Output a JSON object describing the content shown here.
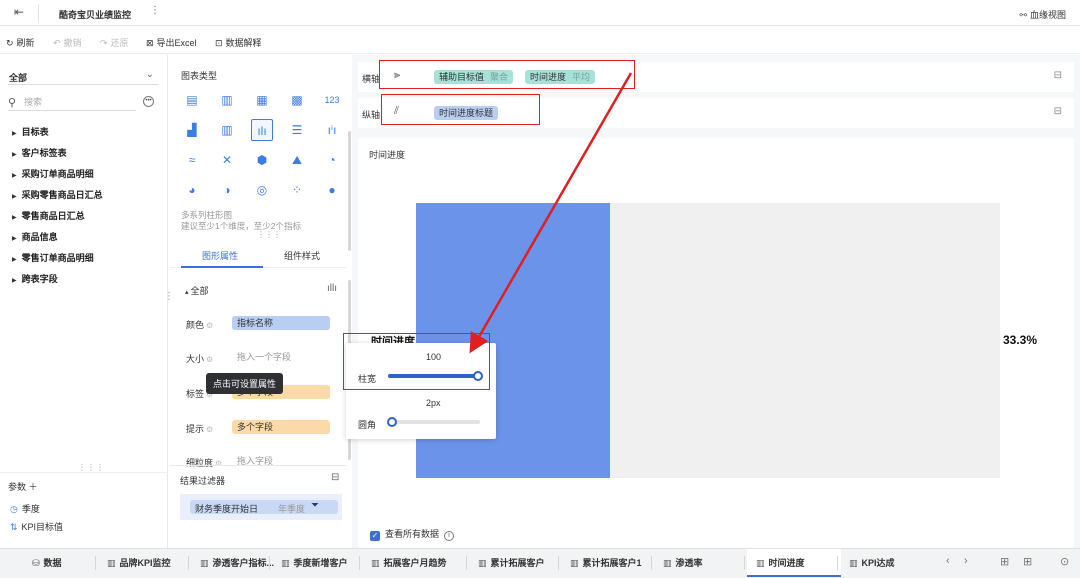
{
  "titlebar": {
    "back_icon": "exit-icon",
    "title": "酷奇宝贝业绩监控",
    "more": "⋮",
    "lineage_label": "血缘视图"
  },
  "toolbar": {
    "refresh": "刷新",
    "undo": "撤销",
    "redo": "还原",
    "export": "导出Excel",
    "explain": "数据解释"
  },
  "left": {
    "scope": "全部",
    "search_placeholder": "搜索",
    "tree": [
      "目标表",
      "客户标签表",
      "采购订单商品明细",
      "采购零售商品日汇总",
      "零售商品日汇总",
      "商品信息",
      "零售订单商品明细",
      "跨表字段"
    ],
    "params_label": "参数 ＋",
    "params": [
      "季度",
      "KPI目标值"
    ]
  },
  "mid": {
    "chart_type_title": "图表类型",
    "chart_desc_line1": "多系列柱形图",
    "chart_desc_line2": "建议至少1个维度，至少2个指标",
    "tabs": [
      "图形属性",
      "组件样式"
    ],
    "all_label": "全部",
    "props": [
      {
        "label": "颜色",
        "value": "指标名称",
        "style": "blue"
      },
      {
        "label": "大小",
        "value": "拖入一个字段",
        "style": "placeholder"
      },
      {
        "label": "标签",
        "value": "多个字段",
        "style": "orange"
      },
      {
        "label": "提示",
        "value": "多个字段",
        "style": "orange"
      },
      {
        "label": "细粒度",
        "value": "拖入字段",
        "style": "placeholder"
      }
    ],
    "tooltip": "点击可设置属性",
    "filters_title": "结果过滤器",
    "filter_field": "财务季度开始日",
    "filter_sub": "年季度"
  },
  "axes": {
    "x_label": "横轴",
    "x_pills": [
      {
        "name": "辅助目标值",
        "agg": "聚合"
      },
      {
        "name": "时间进度",
        "agg": "平均"
      }
    ],
    "y_label": "纵轴",
    "y_pill": "时间进度标题"
  },
  "canvas": {
    "title": "时间进度",
    "cut_label": "时间进度",
    "value_label": "33.3%",
    "show_all": "查看所有数据"
  },
  "popover": {
    "bar_width_value": "100",
    "bar_width_label": "柱宽",
    "radius_value": "2px",
    "radius_label": "圆角"
  },
  "chart_data": {
    "type": "bar",
    "categories": [
      "时间进度"
    ],
    "values": [
      33.3
    ],
    "value_labels": [
      "33.3%"
    ],
    "ylim": [
      0,
      100
    ]
  },
  "bottom_tabs": [
    "数据",
    "品牌KPI监控",
    "渗透客户指标...",
    "季度新增客户",
    "拓展客户月趋势",
    "累计拓展客户",
    "累计拓展客户1",
    "渗透率",
    "时间进度",
    "KPI达成"
  ],
  "colors": {
    "accent": "#3d6fd6",
    "bar": "#6b93ea",
    "annotation": "#e02020"
  }
}
